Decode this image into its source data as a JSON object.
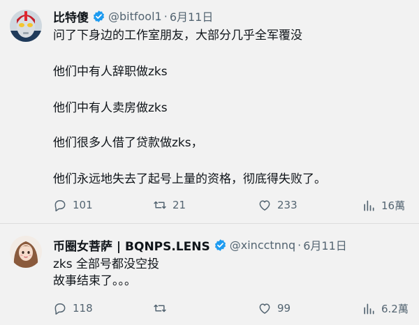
{
  "tweets": [
    {
      "name": "比特傻",
      "handle": "@bitfool1",
      "separator": "·",
      "date": "6月11日",
      "verified": true,
      "avatar_icon": "superhero-avatar",
      "lines": [
        "问了下身边的工作室朋友，大部分几乎全军覆没",
        "他们中有人辞职做zks",
        "他们中有人卖房做zks",
        "他们很多人借了贷款做zks，",
        "他们永远地失去了起号上量的资格，彻底得失败了。"
      ],
      "replies": "101",
      "retweets": "21",
      "likes": "233",
      "views": "16萬"
    },
    {
      "name": "币圈女菩萨 | BQNPS.LENS",
      "handle": "@xincctnnq",
      "separator": "·",
      "date": "6月11日",
      "verified": true,
      "avatar_icon": "cartoon-girl-avatar",
      "lines": [
        "zks 全部号都没空投",
        "故事结束了。。。"
      ],
      "replies": "118",
      "retweets": "",
      "likes": "99",
      "views": "6.2萬"
    }
  ],
  "colors": {
    "background": "#f2f2f2",
    "verified_badge": "#1d9bf0",
    "muted_text": "#536471",
    "main_text": "#0f1419"
  }
}
